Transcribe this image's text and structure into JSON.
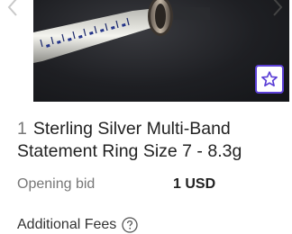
{
  "lot": {
    "number": "1",
    "title": "Sterling Silver Multi-Band Statement Ring Size 7 - 8.3g"
  },
  "bid": {
    "label": "Opening bid",
    "value": "1 USD"
  },
  "fees": {
    "label": "Additional Fees"
  },
  "icons": {
    "prev": "chevron-left-icon",
    "next": "chevron-right-icon",
    "favorite": "star-icon",
    "help": "question-circle-icon"
  },
  "colors": {
    "accent": "#5b3fd6",
    "muted_text": "#777777",
    "text": "#222222"
  }
}
